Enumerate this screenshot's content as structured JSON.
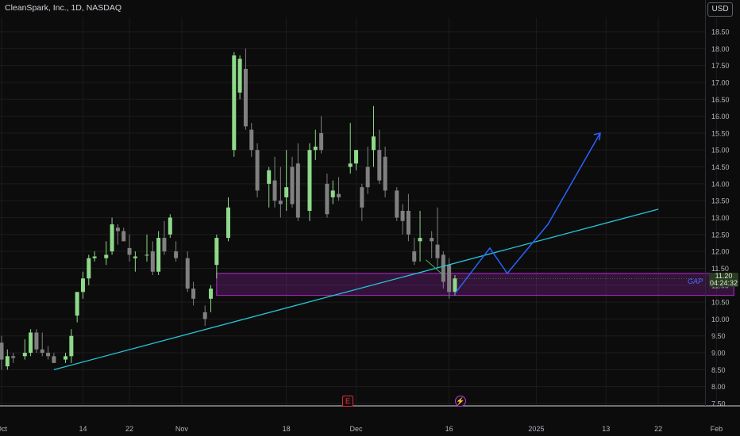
{
  "header": {
    "title": "CleanSpark, Inc., 1D, NASDAQ",
    "currency": "USD"
  },
  "price_tag": {
    "price": "11.20",
    "countdown": "04:24:32"
  },
  "zone_label": "GAP",
  "events": {
    "earnings": "E",
    "dividend": "⚡"
  },
  "colors": {
    "background": "#0c0c0c",
    "grid": "#1c1c1c",
    "up_candle": "#8fd98a",
    "down_candle": "#808080",
    "trendline": "#26c6da",
    "projection": "#2962ff",
    "gap_zone": "#9c27b0",
    "price_tag": "#2a3a23"
  },
  "chart_data": {
    "type": "candlestick",
    "title": "CleanSpark, Inc., 1D, NASDAQ",
    "ylim": [
      7.5,
      18.75
    ],
    "y_ticks": [
      "7.50",
      "8.00",
      "8.50",
      "9.00",
      "9.50",
      "10.00",
      "10.50",
      "11.00",
      "11.50",
      "12.00",
      "12.50",
      "13.00",
      "13.50",
      "14.00",
      "14.50",
      "15.00",
      "15.50",
      "16.00",
      "16.50",
      "17.00",
      "17.50",
      "18.00",
      "18.50"
    ],
    "x_ticks": [
      "Oct",
      "14",
      "22",
      "Nov",
      "18",
      "Dec",
      "16",
      "2025",
      "13",
      "22",
      "Feb"
    ],
    "x_tick_days": [
      0,
      14,
      22,
      31,
      49,
      61,
      77,
      92,
      104,
      113,
      123
    ],
    "last_price": 11.2,
    "candles": [
      {
        "d": 0,
        "o": 9.3,
        "h": 9.5,
        "l": 8.5,
        "c": 8.8
      },
      {
        "d": 1,
        "o": 8.6,
        "h": 9.1,
        "l": 8.5,
        "c": 8.9
      },
      {
        "d": 2,
        "o": 8.9,
        "h": 9.0,
        "l": 8.7,
        "c": 8.85
      },
      {
        "d": 4,
        "o": 8.9,
        "h": 9.4,
        "l": 8.8,
        "c": 9.0
      },
      {
        "d": 5,
        "o": 9.0,
        "h": 9.7,
        "l": 8.9,
        "c": 9.6
      },
      {
        "d": 6,
        "o": 9.6,
        "h": 9.7,
        "l": 9.0,
        "c": 9.1
      },
      {
        "d": 7,
        "o": 9.1,
        "h": 9.6,
        "l": 8.9,
        "c": 9.0
      },
      {
        "d": 8,
        "o": 9.0,
        "h": 9.2,
        "l": 8.8,
        "c": 8.9
      },
      {
        "d": 9,
        "o": 8.9,
        "h": 9.0,
        "l": 8.7,
        "c": 8.7
      },
      {
        "d": 11,
        "o": 8.8,
        "h": 9.0,
        "l": 8.7,
        "c": 8.9
      },
      {
        "d": 12,
        "o": 8.9,
        "h": 9.7,
        "l": 8.7,
        "c": 9.5
      },
      {
        "d": 13,
        "o": 10.1,
        "h": 10.8,
        "l": 9.9,
        "c": 10.8
      },
      {
        "d": 14,
        "o": 10.8,
        "h": 11.4,
        "l": 10.6,
        "c": 11.2
      },
      {
        "d": 15,
        "o": 11.2,
        "h": 11.9,
        "l": 11.0,
        "c": 11.8
      },
      {
        "d": 16,
        "o": 11.8,
        "h": 12.0,
        "l": 11.7,
        "c": 11.85
      },
      {
        "d": 18,
        "o": 11.8,
        "h": 12.3,
        "l": 11.6,
        "c": 11.9
      },
      {
        "d": 19,
        "o": 12.0,
        "h": 13.0,
        "l": 11.9,
        "c": 12.8
      },
      {
        "d": 20,
        "o": 12.7,
        "h": 12.8,
        "l": 12.2,
        "c": 12.6
      },
      {
        "d": 21,
        "o": 12.6,
        "h": 12.7,
        "l": 12.3,
        "c": 12.3
      },
      {
        "d": 22,
        "o": 12.1,
        "h": 12.5,
        "l": 11.7,
        "c": 11.9
      },
      {
        "d": 23,
        "o": 11.8,
        "h": 12.0,
        "l": 11.4,
        "c": 11.85
      },
      {
        "d": 25,
        "o": 11.9,
        "h": 12.5,
        "l": 11.7,
        "c": 11.9
      },
      {
        "d": 26,
        "o": 12.0,
        "h": 12.3,
        "l": 11.3,
        "c": 11.4
      },
      {
        "d": 27,
        "o": 11.4,
        "h": 12.6,
        "l": 11.3,
        "c": 12.4
      },
      {
        "d": 28,
        "o": 12.4,
        "h": 12.9,
        "l": 11.9,
        "c": 12.0
      },
      {
        "d": 29,
        "o": 12.5,
        "h": 13.1,
        "l": 12.4,
        "c": 13.0
      },
      {
        "d": 30,
        "o": 12.0,
        "h": 12.3,
        "l": 11.7,
        "c": 11.8
      },
      {
        "d": 32,
        "o": 11.8,
        "h": 12.0,
        "l": 10.8,
        "c": 10.9
      },
      {
        "d": 33,
        "o": 10.9,
        "h": 11.1,
        "l": 10.4,
        "c": 10.6
      },
      {
        "d": 35,
        "o": 10.2,
        "h": 10.4,
        "l": 9.8,
        "c": 10.0
      },
      {
        "d": 36,
        "o": 10.6,
        "h": 11.0,
        "l": 10.2,
        "c": 10.9
      },
      {
        "d": 37,
        "o": 11.6,
        "h": 12.5,
        "l": 11.2,
        "c": 12.4
      },
      {
        "d": 39,
        "o": 12.4,
        "h": 13.6,
        "l": 12.3,
        "c": 13.3
      },
      {
        "d": 40,
        "o": 15.0,
        "h": 17.9,
        "l": 14.8,
        "c": 17.8
      },
      {
        "d": 41,
        "o": 16.7,
        "h": 17.8,
        "l": 16.5,
        "c": 17.7
      },
      {
        "d": 42,
        "o": 17.4,
        "h": 18.0,
        "l": 15.6,
        "c": 15.7
      },
      {
        "d": 43,
        "o": 15.6,
        "h": 15.8,
        "l": 14.8,
        "c": 15.0
      },
      {
        "d": 44,
        "o": 15.0,
        "h": 15.2,
        "l": 13.6,
        "c": 13.8
      },
      {
        "d": 46,
        "o": 14.0,
        "h": 14.5,
        "l": 13.3,
        "c": 14.4
      },
      {
        "d": 47,
        "o": 14.1,
        "h": 14.8,
        "l": 13.3,
        "c": 13.5
      },
      {
        "d": 48,
        "o": 13.5,
        "h": 14.5,
        "l": 13.0,
        "c": 13.4
      },
      {
        "d": 49,
        "o": 13.6,
        "h": 15.0,
        "l": 13.2,
        "c": 13.9
      },
      {
        "d": 50,
        "o": 14.5,
        "h": 14.8,
        "l": 13.3,
        "c": 13.4
      },
      {
        "d": 51,
        "o": 14.6,
        "h": 15.2,
        "l": 12.9,
        "c": 13.0
      },
      {
        "d": 53,
        "o": 13.2,
        "h": 15.2,
        "l": 12.9,
        "c": 15.0
      },
      {
        "d": 54,
        "o": 15.0,
        "h": 15.6,
        "l": 14.7,
        "c": 15.1
      },
      {
        "d": 55,
        "o": 15.5,
        "h": 16.0,
        "l": 14.9,
        "c": 15.0
      },
      {
        "d": 56,
        "o": 14.0,
        "h": 14.3,
        "l": 13.0,
        "c": 13.1
      },
      {
        "d": 57,
        "o": 13.6,
        "h": 14.1,
        "l": 13.4,
        "c": 13.8
      },
      {
        "d": 58,
        "o": 13.7,
        "h": 14.2,
        "l": 13.5,
        "c": 13.6
      },
      {
        "d": 60,
        "o": 14.5,
        "h": 15.8,
        "l": 14.3,
        "c": 14.6
      },
      {
        "d": 61,
        "o": 14.6,
        "h": 15.0,
        "l": 14.4,
        "c": 15.0
      },
      {
        "d": 62,
        "o": 13.9,
        "h": 14.0,
        "l": 12.9,
        "c": 13.3
      },
      {
        "d": 63,
        "o": 14.5,
        "h": 15.1,
        "l": 13.7,
        "c": 13.9
      },
      {
        "d": 64,
        "o": 15.0,
        "h": 16.3,
        "l": 14.5,
        "c": 15.4
      },
      {
        "d": 65,
        "o": 15.0,
        "h": 15.6,
        "l": 14.0,
        "c": 14.1
      },
      {
        "d": 66,
        "o": 14.8,
        "h": 15.1,
        "l": 13.6,
        "c": 13.8
      },
      {
        "d": 68,
        "o": 13.8,
        "h": 13.9,
        "l": 12.9,
        "c": 13.0
      },
      {
        "d": 69,
        "o": 13.2,
        "h": 13.4,
        "l": 12.5,
        "c": 12.9
      },
      {
        "d": 70,
        "o": 13.2,
        "h": 13.7,
        "l": 12.3,
        "c": 12.5
      },
      {
        "d": 71,
        "o": 12.0,
        "h": 12.4,
        "l": 11.6,
        "c": 11.7
      },
      {
        "d": 72,
        "o": 12.3,
        "h": 13.2,
        "l": 11.7,
        "c": 12.4
      },
      {
        "d": 74,
        "o": 12.4,
        "h": 12.6,
        "l": 11.8,
        "c": 12.3
      },
      {
        "d": 75,
        "o": 12.2,
        "h": 13.3,
        "l": 11.5,
        "c": 11.8
      },
      {
        "d": 76,
        "o": 11.9,
        "h": 12.0,
        "l": 10.9,
        "c": 11.1
      },
      {
        "d": 77,
        "o": 11.6,
        "h": 11.8,
        "l": 10.6,
        "c": 10.8
      },
      {
        "d": 78,
        "o": 10.8,
        "h": 11.3,
        "l": 10.7,
        "c": 11.2
      }
    ],
    "annotations": [
      {
        "type": "gap_zone",
        "label": "GAP",
        "from_day": 37,
        "to_day": 126,
        "y_low": 10.7,
        "y_high": 11.35
      },
      {
        "type": "trendline",
        "points": [
          [
            9,
            8.5
          ],
          [
            113,
            13.25
          ]
        ]
      },
      {
        "type": "projection_path",
        "points": [
          [
            78,
            10.75
          ],
          [
            84,
            12.1
          ],
          [
            87,
            11.35
          ],
          [
            94,
            12.8
          ],
          [
            103,
            15.5
          ]
        ]
      },
      {
        "type": "arrow_head",
        "at": [
          103,
          15.5
        ]
      },
      {
        "type": "guide_segment",
        "points": [
          [
            73,
            11.75
          ],
          [
            76,
            11.3
          ]
        ]
      }
    ]
  }
}
